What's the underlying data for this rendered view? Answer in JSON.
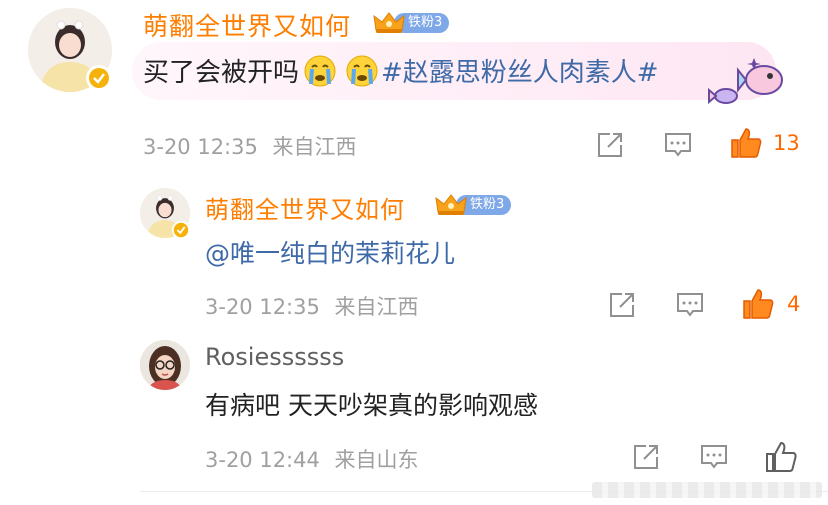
{
  "comments": [
    {
      "username": "萌翻全世界又如何",
      "fan_badge": "铁粉3",
      "text": "买了会被开吗",
      "topic": "#赵露思粉丝人肉素人#",
      "date": "3-20 12:35",
      "location": "来自江西",
      "likes": "13",
      "emoji": "crying-face-emoji",
      "verified": true
    },
    {
      "username": "萌翻全世界又如何",
      "fan_badge": "铁粉3",
      "mention": "@唯一纯白的茉莉花儿",
      "date": "3-20 12:35",
      "location": "来自江西",
      "likes": "4",
      "verified": true
    },
    {
      "username": "Rosiessssss",
      "text": "有病吧 天天吵架真的影响观感",
      "date": "3-20 12:44",
      "location": "来自山东",
      "likes": ""
    }
  ],
  "icons": {
    "share": "share-icon",
    "comment": "comment-icon",
    "like": "thumbs-up-icon"
  },
  "colors": {
    "username_accent": "#ff7d00",
    "like_active": "#ff6a00",
    "link": "#3f6aa8",
    "fan_badge": "#7ea8e8"
  }
}
